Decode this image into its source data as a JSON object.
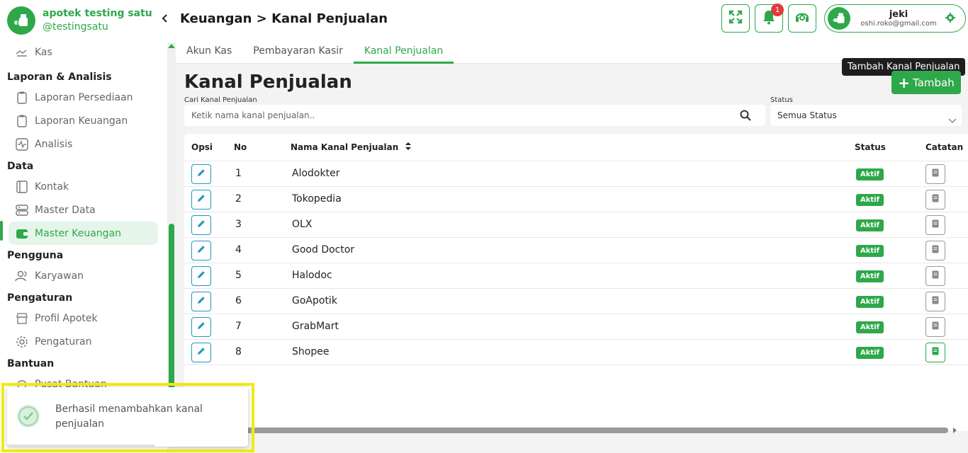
{
  "brand": {
    "name": "apotek testing satu",
    "handle": "@testingsatu"
  },
  "header": {
    "title": "Keuangan > Kanal Penjualan",
    "notification_count": "1"
  },
  "user": {
    "name": "jeki",
    "email": "oshi.roko@gmail.com"
  },
  "sidebar": {
    "top_item": {
      "label": "Kas",
      "icon": "cash-icon"
    },
    "sections": [
      {
        "title": "Laporan & Analisis",
        "items": [
          {
            "label": "Laporan Persediaan",
            "icon": "clipboard-icon"
          },
          {
            "label": "Laporan Keuangan",
            "icon": "clipboard-icon"
          },
          {
            "label": "Analisis",
            "icon": "activity-icon"
          }
        ]
      },
      {
        "title": "Data",
        "items": [
          {
            "label": "Kontak",
            "icon": "contact-book-icon"
          },
          {
            "label": "Master Data",
            "icon": "database-icon"
          },
          {
            "label": "Master Keuangan",
            "icon": "wallet-icon",
            "active": true
          }
        ]
      },
      {
        "title": "Pengguna",
        "items": [
          {
            "label": "Karyawan",
            "icon": "users-icon"
          }
        ]
      },
      {
        "title": "Pengaturan",
        "items": [
          {
            "label": "Profil Apotek",
            "icon": "store-icon"
          },
          {
            "label": "Pengaturan",
            "icon": "gear-icon"
          }
        ]
      },
      {
        "title": "Bantuan",
        "items": [
          {
            "label": "Pusat Bantuan",
            "icon": "help-icon"
          }
        ]
      }
    ]
  },
  "tabs": [
    {
      "label": "Akun Kas"
    },
    {
      "label": "Pembayaran Kasir"
    },
    {
      "label": "Kanal Penjualan",
      "active": true
    }
  ],
  "main": {
    "title": "Kanal Penjualan",
    "tooltip": "Tambah Kanal Penjualan",
    "add_label": "Tambah",
    "search_label": "Cari Kanal Penjualan",
    "search_placeholder": "Ketik nama kanal penjualan..",
    "status_label": "Status",
    "status_value": "Semua Status"
  },
  "table": {
    "columns": [
      "Opsi",
      "No",
      "Nama Kanal Penjualan",
      "Status",
      "Catatan"
    ],
    "rows": [
      {
        "no": "1",
        "name": "Alodokter",
        "status": "Aktif",
        "has_note": false
      },
      {
        "no": "2",
        "name": "Tokopedia",
        "status": "Aktif",
        "has_note": false
      },
      {
        "no": "3",
        "name": "OLX",
        "status": "Aktif",
        "has_note": false
      },
      {
        "no": "4",
        "name": "Good Doctor",
        "status": "Aktif",
        "has_note": false
      },
      {
        "no": "5",
        "name": "Halodoc",
        "status": "Aktif",
        "has_note": false
      },
      {
        "no": "6",
        "name": "GoApotik",
        "status": "Aktif",
        "has_note": false
      },
      {
        "no": "7",
        "name": "GrabMart",
        "status": "Aktif",
        "has_note": false
      },
      {
        "no": "8",
        "name": "Shopee",
        "status": "Aktif",
        "has_note": true
      }
    ]
  },
  "toast": {
    "message": "Berhasil menambahkan kanal penjualan"
  },
  "colors": {
    "accent": "#2ea84a",
    "edit": "#2596be",
    "badge_notif": "#e23b3b",
    "highlight": "#f3ea14"
  }
}
